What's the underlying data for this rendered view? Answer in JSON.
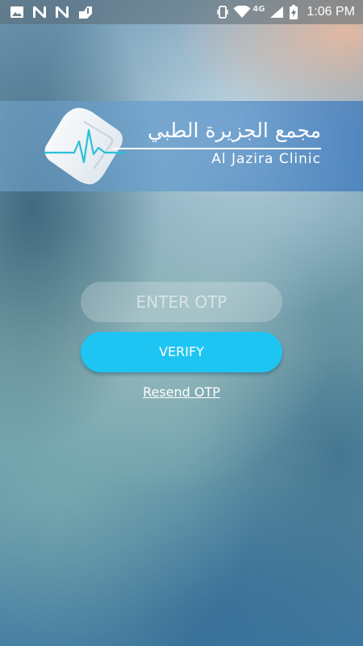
{
  "status_bar": {
    "left_icons": [
      "image-icon",
      "n-notification-icon",
      "n-notification-icon",
      "notification-1-icon"
    ],
    "right_icons": [
      "vibrate-icon",
      "wifi-icon",
      "signal-icon",
      "battery-charging-icon"
    ],
    "network_label": "4G",
    "time": "1:06 PM"
  },
  "logo": {
    "arabic_name": "مجمع الجزيرة الطبي",
    "english_name": "Al Jazira Clinic",
    "icon": "heartbeat-diamond-icon"
  },
  "form": {
    "otp_placeholder": "ENTER OTP",
    "otp_value": "",
    "verify_label": "VERIFY",
    "resend_label": "Resend OTP"
  },
  "colors": {
    "verify_button": "#1ec5f3",
    "logo_accent": "#2bbfd6",
    "text": "#ffffff"
  }
}
